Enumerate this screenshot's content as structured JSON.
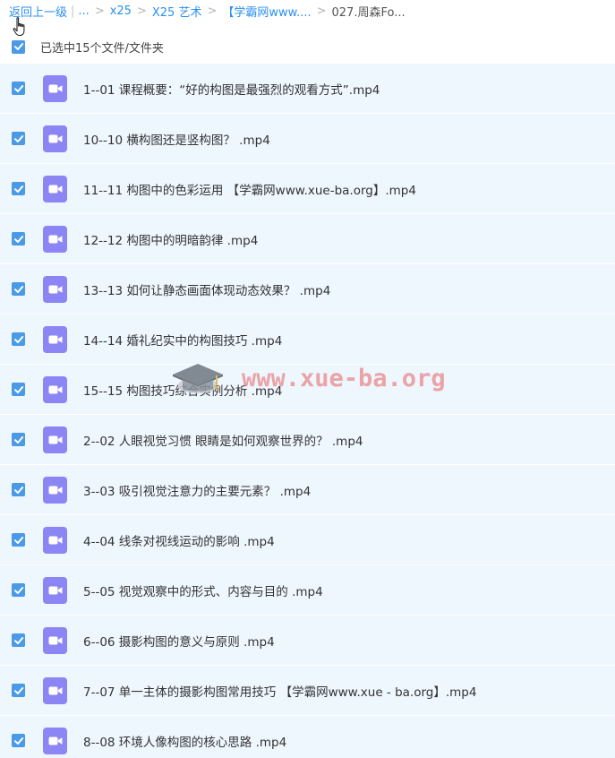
{
  "breadcrumb": {
    "back": "返回上一级",
    "ellipsis": "...",
    "items": [
      "x25",
      "X25 艺术",
      "【学霸网www...."
    ],
    "current": "027.周森Fo..."
  },
  "selection": {
    "label": "已选中15个文件/文件夹",
    "checked": true
  },
  "icons": {
    "checkbox": "check-icon",
    "file": "video-file-icon",
    "cursor": "hand-pointer-icon"
  },
  "colors": {
    "accent": "#2b8ff0",
    "checkbox": "#4a9ae8",
    "row_bg": "#eef6fe",
    "video_icon": "#8c86f5"
  },
  "files": [
    {
      "name": "1--01 课程概要：“好的构图是最强烈的观看方式”.mp4",
      "checked": true
    },
    {
      "name": "10--10 横构图还是竖构图？ .mp4",
      "checked": true
    },
    {
      "name": "11--11 构图中的色彩运用 【学霸网www.xue-ba.org】.mp4",
      "checked": true
    },
    {
      "name": "12--12 构图中的明暗韵律 .mp4",
      "checked": true
    },
    {
      "name": "13--13 如何让静态画面体现动态效果？ .mp4",
      "checked": true
    },
    {
      "name": "14--14 婚礼纪实中的构图技巧 .mp4",
      "checked": true
    },
    {
      "name": "15--15 构图技巧综合实例分析 .mp4",
      "checked": true
    },
    {
      "name": "2--02 人眼视觉习惯 眼睛是如何观察世界的？ .mp4",
      "checked": true
    },
    {
      "name": "3--03 吸引视觉注意力的主要元素？ .mp4",
      "checked": true
    },
    {
      "name": "4--04 线条对视线运动的影响 .mp4",
      "checked": true
    },
    {
      "name": "5--05 视觉观察中的形式、内容与目的 .mp4",
      "checked": true
    },
    {
      "name": "6--06 摄影构图的意义与原则 .mp4",
      "checked": true
    },
    {
      "name": "7--07 单一主体的摄影构图常用技巧 【学霸网www.xue - ba.org】.mp4",
      "checked": true
    },
    {
      "name": "8--08 环境人像构图的核心思路 .mp4",
      "checked": true
    }
  ],
  "watermark": {
    "text": "www.xue-ba.org"
  }
}
